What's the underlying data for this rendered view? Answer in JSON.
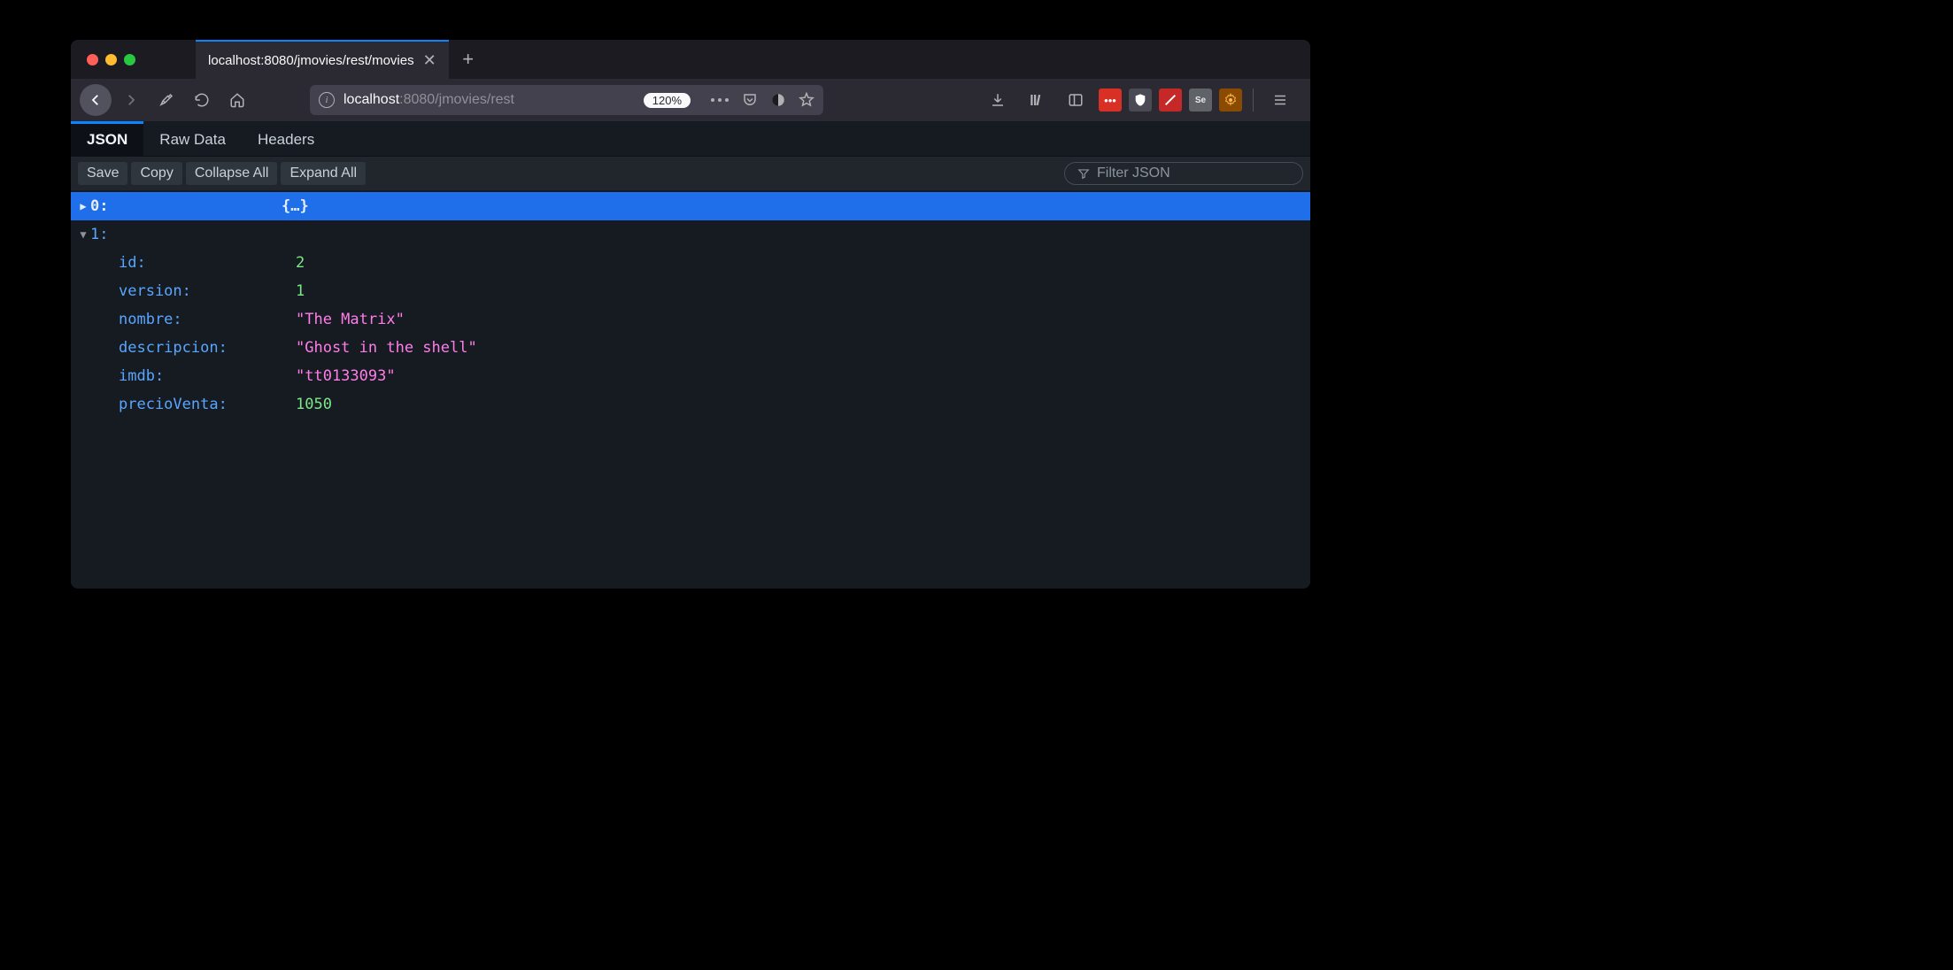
{
  "tab": {
    "title": "localhost:8080/jmovies/rest/movies"
  },
  "url": {
    "host": "localhost",
    "rest": ":8080/jmovies/rest",
    "zoom": "120%"
  },
  "viewerTabs": {
    "json": "JSON",
    "raw": "Raw Data",
    "headers": "Headers"
  },
  "actions": {
    "save": "Save",
    "copy": "Copy",
    "collapse": "Collapse All",
    "expand": "Expand All"
  },
  "filter": {
    "placeholder": "Filter JSON"
  },
  "tree": {
    "row0": {
      "key": "0:",
      "preview": "{…}"
    },
    "row1": {
      "key": "1:"
    },
    "fields": {
      "id": {
        "key": "id:",
        "value": "2"
      },
      "version": {
        "key": "version:",
        "value": "1"
      },
      "nombre": {
        "key": "nombre:",
        "value": "\"The Matrix\""
      },
      "descripcion": {
        "key": "descripcion:",
        "value": "\"Ghost in the shell\""
      },
      "imdb": {
        "key": "imdb:",
        "value": "\"tt0133093\""
      },
      "precioVenta": {
        "key": "precioVenta:",
        "value": "1050"
      }
    }
  }
}
